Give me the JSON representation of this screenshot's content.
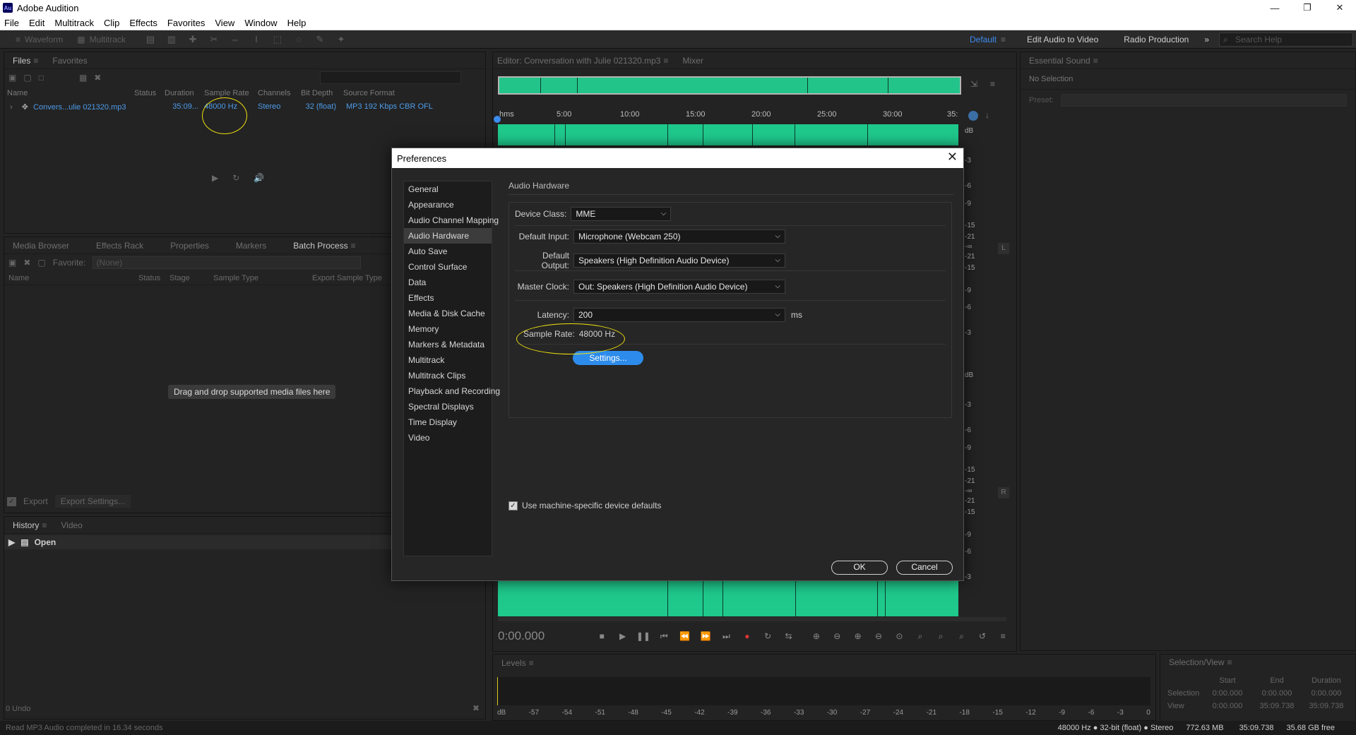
{
  "app": {
    "title": "Adobe Audition",
    "logo": "Au"
  },
  "menu": [
    "File",
    "Edit",
    "Multitrack",
    "Clip",
    "Effects",
    "Favorites",
    "View",
    "Window",
    "Help"
  ],
  "toolbar": {
    "waveform_label": "Waveform",
    "multitrack_label": "Multitrack",
    "workspaces": [
      "Default",
      "Edit Audio to Video",
      "Radio Production"
    ],
    "search_placeholder": "Search Help"
  },
  "files_panel": {
    "tabs": [
      "Files",
      "Favorites"
    ],
    "columns": [
      "Name",
      "Status",
      "Duration",
      "Sample Rate",
      "Channels",
      "Bit Depth",
      "Source Format"
    ],
    "rows": [
      {
        "name": "Convers...ulie 021320.mp3",
        "status": "",
        "duration": "35:09...",
        "sample_rate": "48000 Hz",
        "channels": "Stereo",
        "bit_depth": "32 (float)",
        "source_format": "MP3 192 Kbps CBR OFL"
      }
    ]
  },
  "batch_panel": {
    "tabs": [
      "Media Browser",
      "Effects Rack",
      "Properties",
      "Markers",
      "Batch Process"
    ],
    "favorite_label": "Favorite:",
    "favorite_value": "(None)",
    "columns": [
      "Name",
      "Status",
      "Stage",
      "Sample Type",
      "Export Sample Type"
    ],
    "drop_hint": "Drag and drop supported media files here",
    "export_label": "Export",
    "export_settings": "Export Settings..."
  },
  "history_panel": {
    "tabs": [
      "History",
      "Video"
    ],
    "items": [
      "Open"
    ],
    "undo_count": "0 Undo"
  },
  "editor": {
    "tabs": [
      "Editor: Conversation with Julie 021320.mp3",
      "Mixer"
    ],
    "ruler": [
      "hms",
      "5:00",
      "10:00",
      "15:00",
      "20:00",
      "25:00",
      "30:00",
      "35:"
    ],
    "db_top": [
      "dB",
      "-3",
      "-6",
      "-9",
      "-15",
      "-21",
      "-∞",
      "-21",
      "-15",
      "-9",
      "-6",
      "-3"
    ],
    "db_bottom": [
      "dB",
      "-3",
      "-6",
      "-9",
      "-15",
      "-21",
      "-∞",
      "-21",
      "-15",
      "-9",
      "-6",
      "-3"
    ],
    "channel_l": "L",
    "channel_r": "R",
    "time": "0:00.000"
  },
  "levels": {
    "title": "Levels",
    "scale": [
      "dB",
      "-57",
      "-54",
      "-51",
      "-48",
      "-45",
      "-42",
      "-39",
      "-36",
      "-33",
      "-30",
      "-27",
      "-24",
      "-21",
      "-18",
      "-15",
      "-12",
      "-9",
      "-6",
      "-3",
      "0"
    ]
  },
  "essential_sound": {
    "title": "Essential Sound",
    "no_selection": "No Selection",
    "preset_label": "Preset:"
  },
  "selection_view": {
    "title": "Selection/View",
    "headers": [
      "Start",
      "End",
      "Duration"
    ],
    "rows": [
      {
        "label": "Selection",
        "start": "0:00.000",
        "end": "0:00.000",
        "duration": "0:00.000"
      },
      {
        "label": "View",
        "start": "0:00.000",
        "end": "35:09.738",
        "duration": "35:09.738"
      }
    ]
  },
  "status_bar": {
    "message": "Read MP3 Audio completed in 16.34 seconds",
    "format": "48000 Hz ● 32-bit (float) ● Stereo",
    "file_size": "772.63 MB",
    "duration": "35:09.738",
    "free_space": "35.68 GB free"
  },
  "preferences": {
    "title": "Preferences",
    "nav": [
      "General",
      "Appearance",
      "Audio Channel Mapping",
      "Audio Hardware",
      "Auto Save",
      "Control Surface",
      "Data",
      "Effects",
      "Media & Disk Cache",
      "Memory",
      "Markers & Metadata",
      "Multitrack",
      "Multitrack Clips",
      "Playback and Recording",
      "Spectral Displays",
      "Time Display",
      "Video"
    ],
    "active_index": 3,
    "section": "Audio Hardware",
    "device_class_label": "Device Class:",
    "device_class": "MME",
    "default_input_label": "Default Input:",
    "default_input": "Microphone (Webcam 250)",
    "default_output_label": "Default Output:",
    "default_output": "Speakers (High Definition Audio Device)",
    "master_clock_label": "Master Clock:",
    "master_clock": "Out: Speakers (High Definition Audio Device)",
    "latency_label": "Latency:",
    "latency": "200",
    "latency_unit": "ms",
    "sample_rate_label": "Sample Rate:",
    "sample_rate": "48000 Hz",
    "settings_button": "Settings...",
    "machine_defaults": "Use machine-specific device defaults",
    "ok": "OK",
    "cancel": "Cancel"
  }
}
